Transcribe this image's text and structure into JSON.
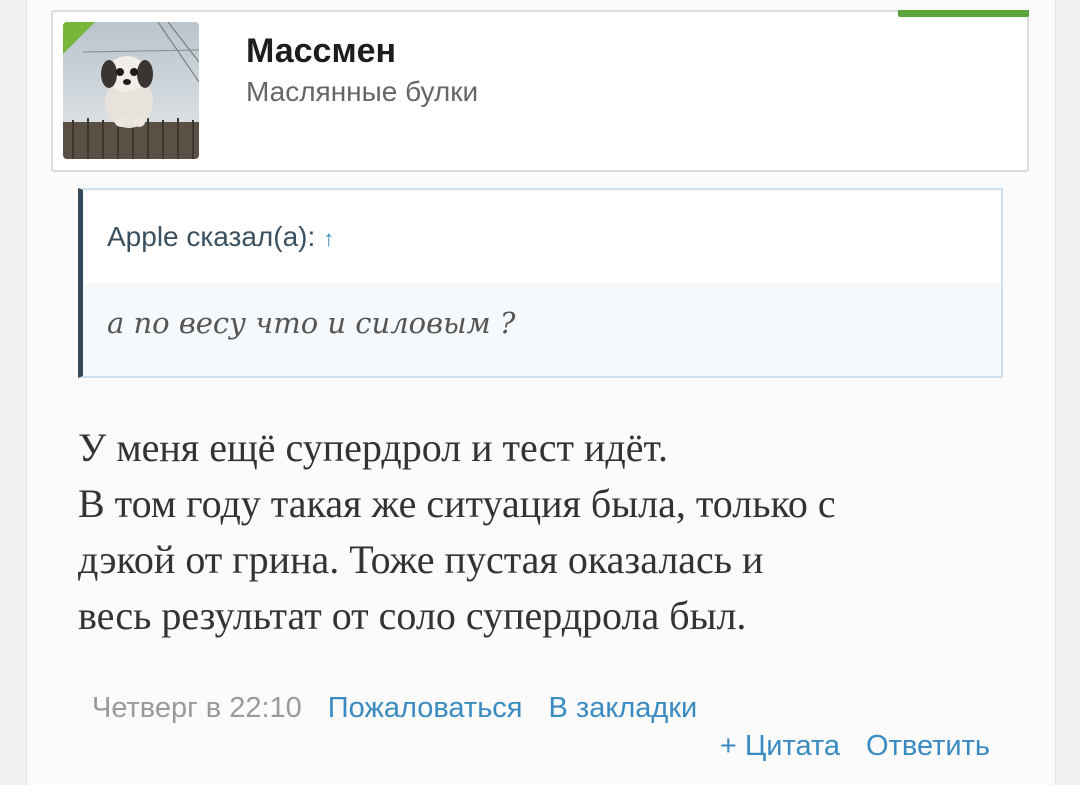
{
  "user": {
    "name": "Массмен",
    "title": "Маслянные булки",
    "avatar_icon": "dog-avatar",
    "accent_color": "#76b73a"
  },
  "quote": {
    "author_line": "Apple сказал(а):",
    "arrow": "↑",
    "text": "а по весу что и силовым ?",
    "border_color": "#35495a"
  },
  "message": {
    "lines": [
      "У меня ещё супердрол и тест идёт.",
      "В том году такая же ситуация была, только с",
      "дэкой от грина. Тоже пустая оказалась и",
      "весь результат от соло супердрола был."
    ]
  },
  "meta": {
    "date": "Четверг в 22:10",
    "report": "Пожаловаться",
    "bookmark": "В закладки",
    "quote_action": "+ Цитата",
    "reply": "Ответить",
    "link_color": "#3a8bc2"
  }
}
